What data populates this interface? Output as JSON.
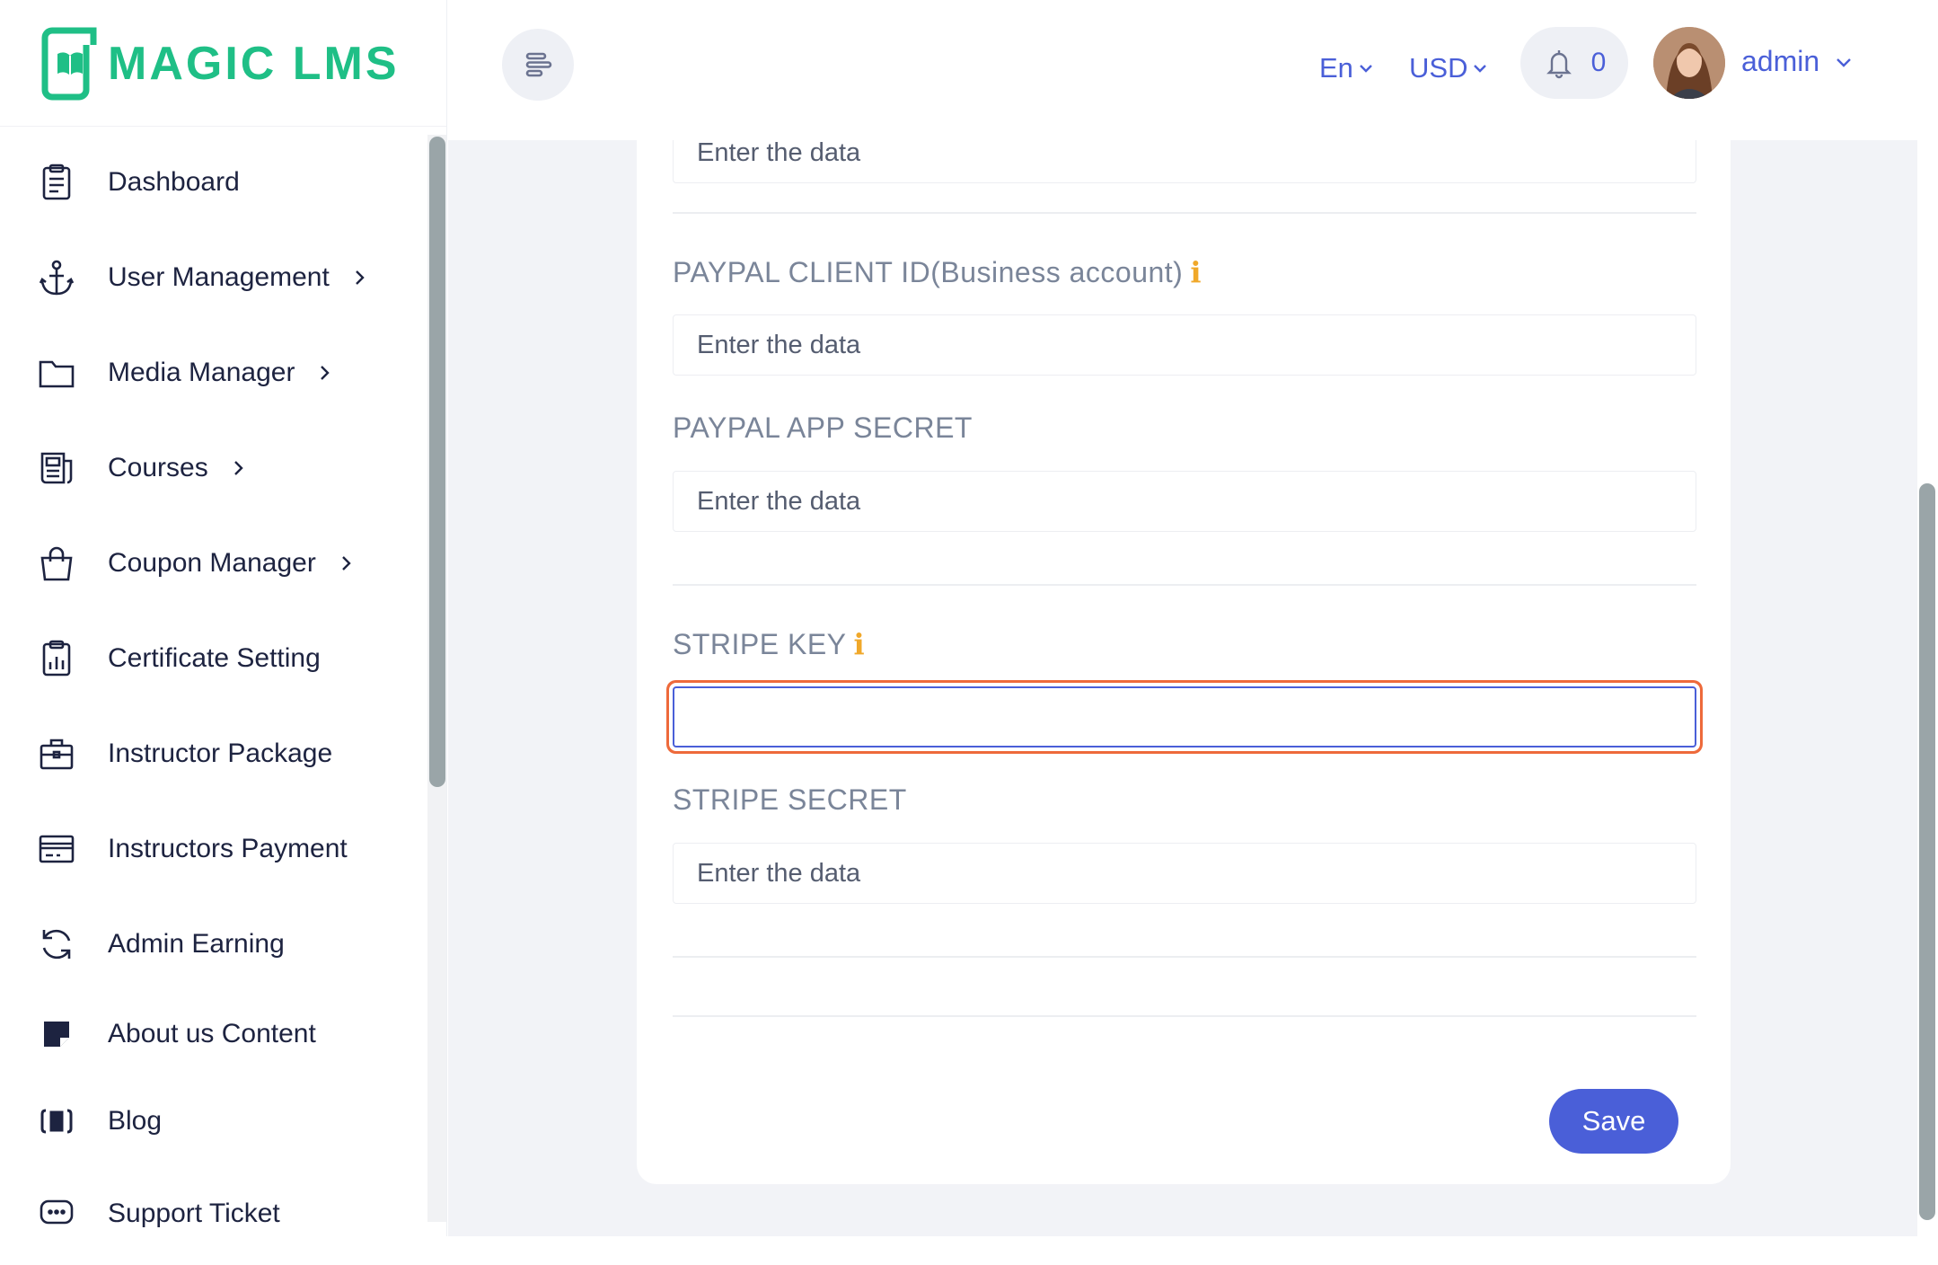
{
  "brand": {
    "name": "MAGIC LMS",
    "color": "#1fbf86"
  },
  "sidebar": {
    "items": [
      {
        "label": "Dashboard",
        "icon": "clipboard-list-icon",
        "has_submenu": false
      },
      {
        "label": "User Management",
        "icon": "anchor-icon",
        "has_submenu": true
      },
      {
        "label": "Media Manager",
        "icon": "folder-icon",
        "has_submenu": true
      },
      {
        "label": "Courses",
        "icon": "newspaper-icon",
        "has_submenu": true
      },
      {
        "label": "Coupon Manager",
        "icon": "shopping-bag-icon",
        "has_submenu": true
      },
      {
        "label": "Certificate Setting",
        "icon": "clipboard-chart-icon",
        "has_submenu": false
      },
      {
        "label": "Instructor Package",
        "icon": "briefcase-icon",
        "has_submenu": false
      },
      {
        "label": "Instructors Payment",
        "icon": "credit-card-icon",
        "has_submenu": false
      },
      {
        "label": "Admin Earning",
        "icon": "refresh-icon",
        "has_submenu": false
      },
      {
        "label": "About us Content",
        "icon": "sticky-note-icon",
        "has_submenu": false
      },
      {
        "label": "Blog",
        "icon": "blog-icon",
        "has_submenu": false
      },
      {
        "label": "Support Ticket",
        "icon": "chat-bubble-icon",
        "has_submenu": false
      }
    ]
  },
  "header": {
    "language": "En",
    "currency": "USD",
    "notification_count": "0",
    "user_name": "admin",
    "accent": "#4a5fd8"
  },
  "form": {
    "placeholder": "Enter the data",
    "fields": [
      {
        "label": "PAYPAL CLIENT ID(Business account)",
        "has_info": true,
        "value": ""
      },
      {
        "label": "PAYPAL APP SECRET",
        "has_info": false,
        "value": ""
      },
      {
        "label": "STRIPE KEY",
        "has_info": true,
        "value": "",
        "focused": true
      },
      {
        "label": "STRIPE SECRET",
        "has_info": false,
        "value": ""
      }
    ],
    "info_glyph": "i",
    "save_label": "Save"
  }
}
